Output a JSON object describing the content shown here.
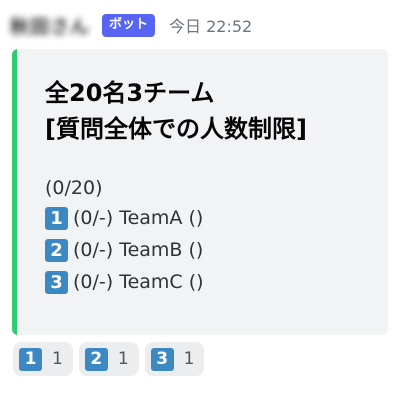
{
  "message": {
    "username": "秋田さん",
    "bot_tag": "ボット",
    "timestamp": "今日 22:52"
  },
  "embed": {
    "accent_color": "#2ecc71",
    "title_line1": "全20名3チーム",
    "title_line2": "[質問全体での人数制限]",
    "total": "(0/20)",
    "teams": [
      {
        "number": "1",
        "text": "(0/-) TeamA ()"
      },
      {
        "number": "2",
        "text": "(0/-) TeamB ()"
      },
      {
        "number": "3",
        "text": "(0/-) TeamC ()"
      }
    ]
  },
  "reactions": [
    {
      "emoji": "1",
      "count": "1"
    },
    {
      "emoji": "2",
      "count": "1"
    },
    {
      "emoji": "3",
      "count": "1"
    }
  ],
  "colors": {
    "bot_tag": "#5865f2",
    "keycap": "#3b88c3",
    "embed_background": "#f2f3f5",
    "reaction_background": "#ebedef"
  }
}
